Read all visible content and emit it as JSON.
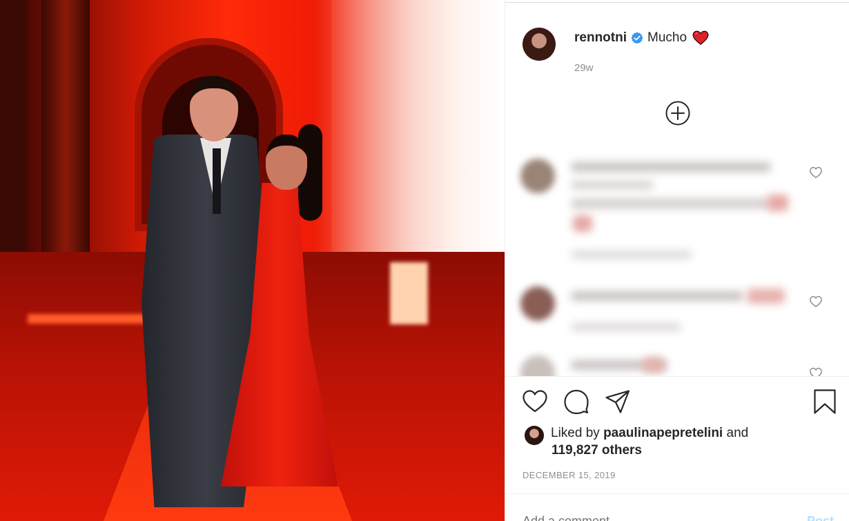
{
  "post": {
    "username": "rennotni",
    "caption": "Mucho",
    "caption_emoji": "red-heart",
    "time_ago": "29w",
    "verified": true
  },
  "actions": {
    "like_icon": "heart-outline-icon",
    "comment_icon": "comment-icon",
    "share_icon": "share-icon",
    "save_icon": "bookmark-icon",
    "load_more_icon": "plus-circle-icon"
  },
  "likes": {
    "prefix": "Liked by",
    "liker": "paaulinapepretelini",
    "conjunction": "and",
    "others": "119,827 others"
  },
  "date": "DECEMBER 15, 2019",
  "comment_box": {
    "placeholder": "Add a comment…",
    "post_label": "Post"
  },
  "colors": {
    "accent_verified": "#3897f0",
    "emoji_heart": "#e0202a",
    "text_primary": "#262626",
    "text_secondary": "#8e8e8e",
    "post_button": "#b2dffc"
  }
}
